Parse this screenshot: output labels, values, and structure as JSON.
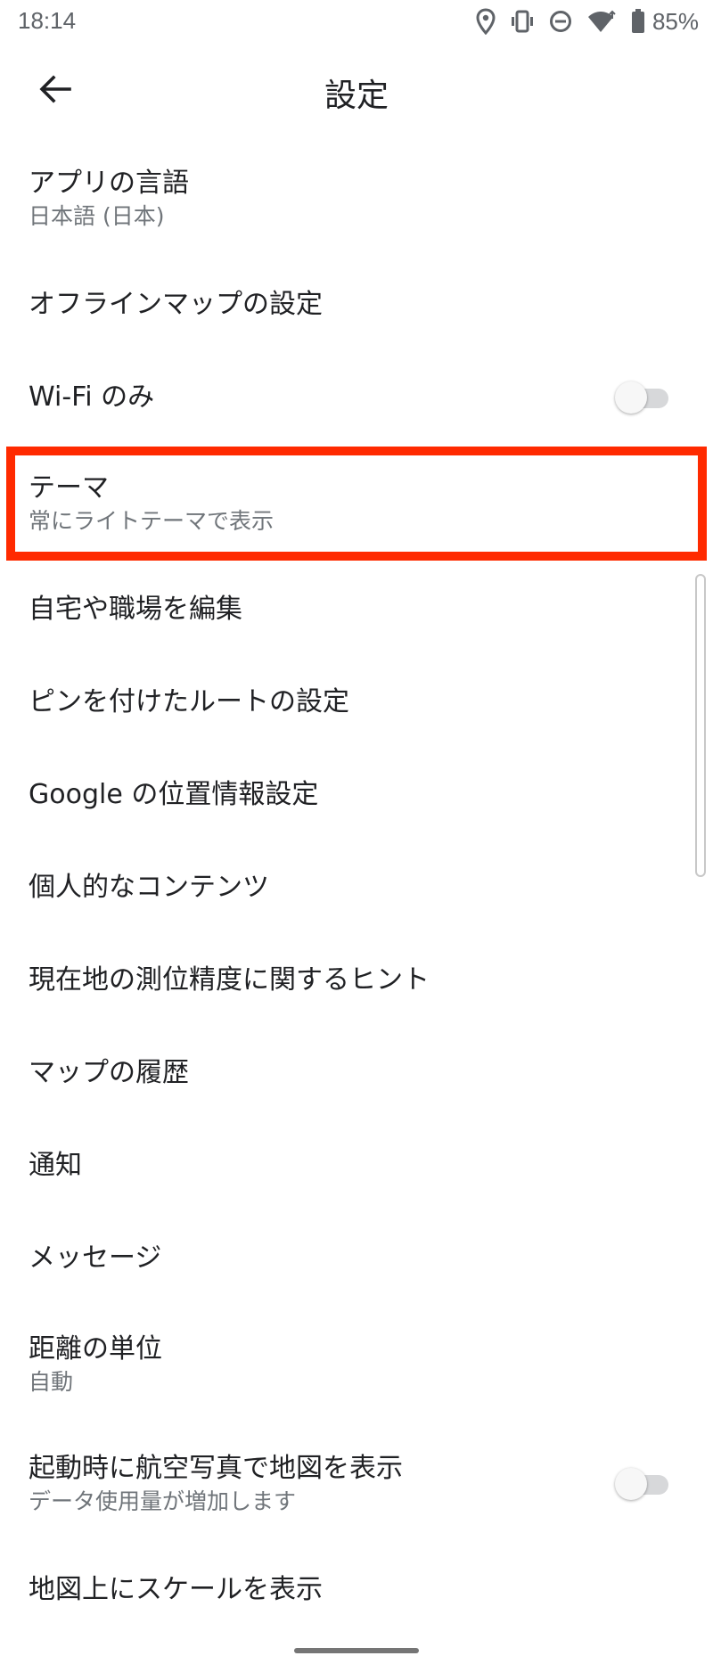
{
  "status_bar": {
    "time": "18:14",
    "battery_percent": "85%",
    "icons": [
      "location-icon",
      "vibrate-icon",
      "do-not-disturb-icon",
      "wifi-icon",
      "battery-icon"
    ]
  },
  "app_bar": {
    "title": "設定",
    "back_icon": "arrow-back-icon"
  },
  "settings": {
    "app_language": {
      "title": "アプリの言語",
      "value": "日本語 (日本)"
    },
    "offline_maps": {
      "title": "オフラインマップの設定"
    },
    "wifi_only": {
      "title": "Wi-Fi のみ",
      "enabled": false
    },
    "theme": {
      "title": "テーマ",
      "value": "常にライトテーマで表示",
      "highlighted": true,
      "highlight_color": "#ff2a00"
    },
    "home_work": {
      "title": "自宅や職場を編集"
    },
    "pinned_routes": {
      "title": "ピンを付けたルートの設定"
    },
    "google_location": {
      "title": "Google の位置情報設定"
    },
    "personal_content": {
      "title": "個人的なコンテンツ"
    },
    "location_accuracy": {
      "title": "現在地の測位精度に関するヒント"
    },
    "maps_history": {
      "title": "マップの履歴"
    },
    "notifications": {
      "title": "通知"
    },
    "messages": {
      "title": "メッセージ"
    },
    "distance_units": {
      "title": "距離の単位",
      "value": "自動"
    },
    "satellite_on_start": {
      "title": "起動時に航空写真で地図を表示",
      "value": "データ使用量が増加します",
      "enabled": false
    },
    "show_scale": {
      "title": "地図上にスケールを表示"
    }
  },
  "colors": {
    "text_primary": "#202124",
    "text_secondary": "#70757a",
    "highlight": "#ff2a00"
  }
}
